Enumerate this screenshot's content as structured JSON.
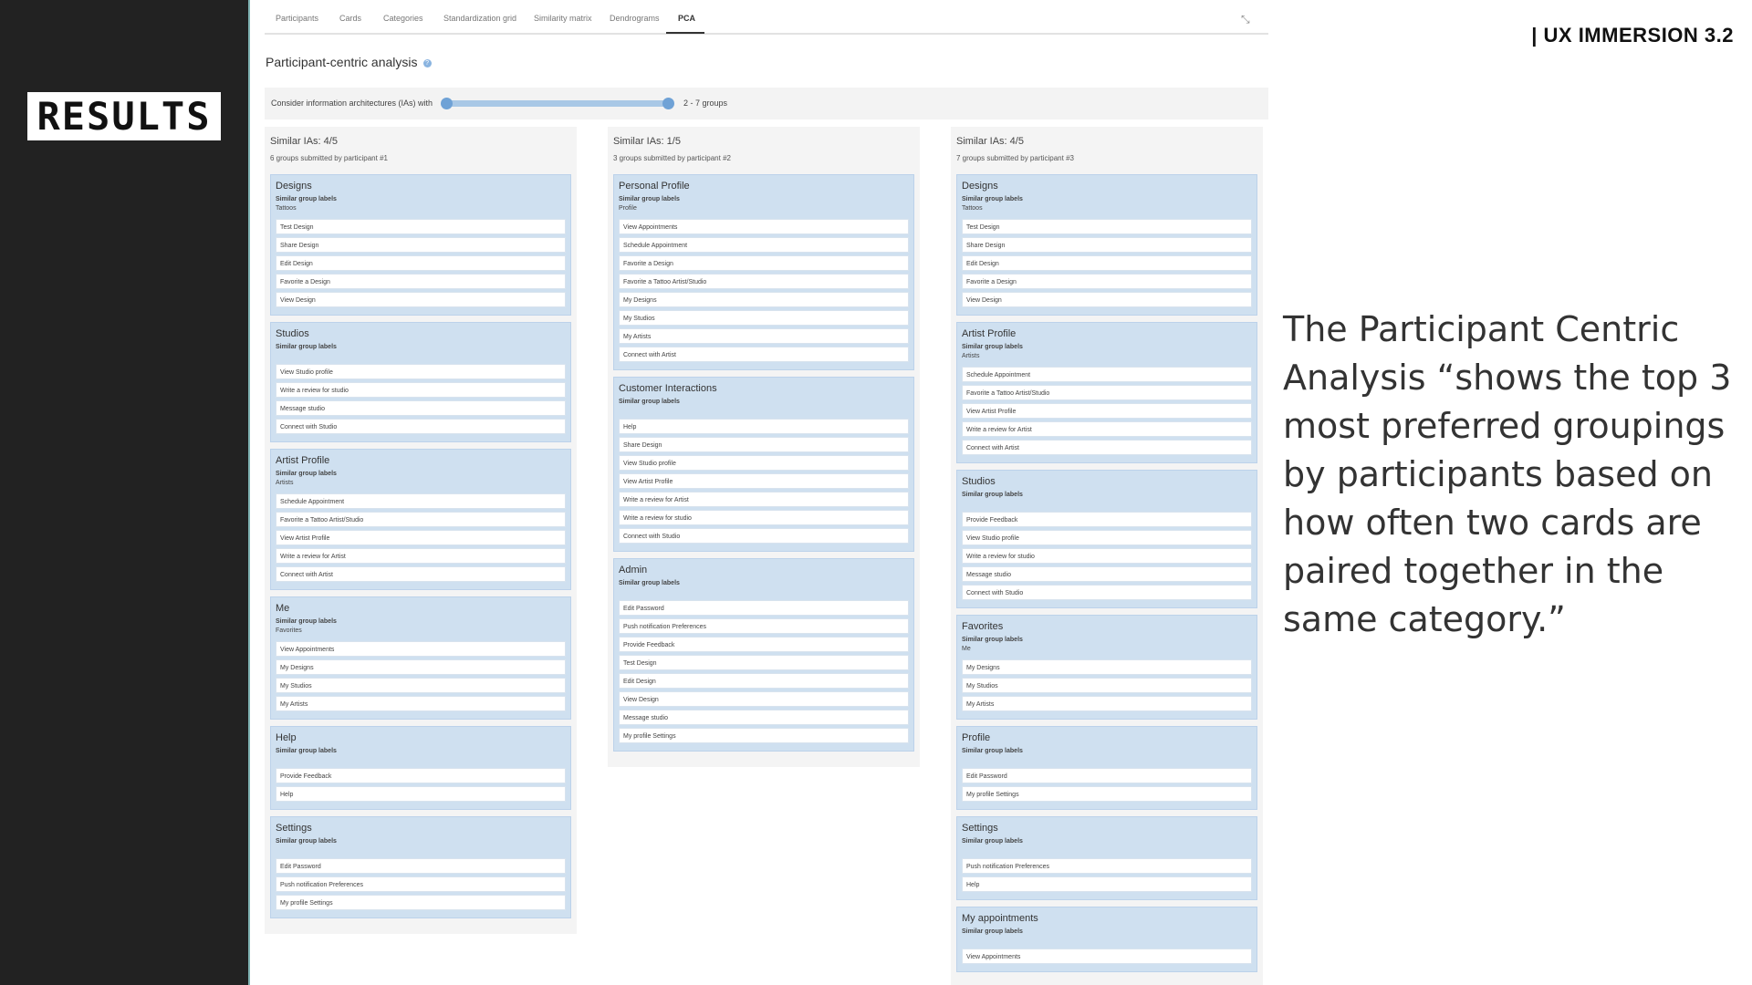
{
  "slide": {
    "results_label": "RESULTS",
    "header": "|  UX IMMERSION 3.2",
    "quote": "The Participant Centric Analysis “shows the top 3 most preferred groupings by participants based on how often two cards are paired together in the same category.”"
  },
  "tabs": [
    {
      "label": "Participants"
    },
    {
      "label": "Cards"
    },
    {
      "label": "Categories"
    },
    {
      "label": "Standardization grid"
    },
    {
      "label": "Similarity matrix"
    },
    {
      "label": "Dendrograms"
    },
    {
      "label": "PCA"
    }
  ],
  "section": {
    "title": "Participant-centric analysis",
    "info_icon": "?"
  },
  "filter": {
    "label": "Consider information architectures (IAs) with",
    "value": "2 - 7 groups"
  },
  "columns": [
    {
      "title": "Similar IAs: 4/5",
      "subtitle": "6 groups submitted by participant #1",
      "groups": [
        {
          "title": "Designs",
          "sub": "Similar group labels",
          "labels": "Tattoos",
          "cards": [
            "Test Design",
            "Share Design",
            "Edit Design",
            "Favorite a Design",
            "View Design"
          ]
        },
        {
          "title": "Studios",
          "sub": "Similar group labels",
          "labels": "",
          "cards": [
            "View Studio profile",
            "Write a review for studio",
            "Message studio",
            "Connect with Studio"
          ]
        },
        {
          "title": "Artist Profile",
          "sub": "Similar group labels",
          "labels": "Artists",
          "cards": [
            "Schedule Appointment",
            "Favorite a Tattoo Artist/Studio",
            "View Artist Profile",
            "Write a review for Artist",
            "Connect with Artist"
          ]
        },
        {
          "title": "Me",
          "sub": "Similar group labels",
          "labels": "Favorites",
          "cards": [
            "View Appointments",
            "My Designs",
            "My Studios",
            "My Artists"
          ]
        },
        {
          "title": "Help",
          "sub": "Similar group labels",
          "labels": "",
          "cards": [
            "Provide Feedback",
            "Help"
          ]
        },
        {
          "title": "Settings",
          "sub": "Similar group labels",
          "labels": "",
          "cards": [
            "Edit Password",
            "Push notification Preferences",
            "My profile Settings"
          ]
        }
      ]
    },
    {
      "title": "Similar IAs: 1/5",
      "subtitle": "3 groups submitted by participant #2",
      "groups": [
        {
          "title": "Personal Profile",
          "sub": "Similar group labels",
          "labels": "Profile",
          "cards": [
            "View Appointments",
            "Schedule Appointment",
            "Favorite a Design",
            "Favorite a Tattoo Artist/Studio",
            "My Designs",
            "My Studios",
            "My Artists",
            "Connect with Artist"
          ]
        },
        {
          "title": "Customer Interactions",
          "sub": "Similar group labels",
          "labels": "",
          "cards": [
            "Help",
            "Share Design",
            "View Studio profile",
            "View Artist Profile",
            "Write a review for Artist",
            "Write a review for studio",
            "Connect with Studio"
          ]
        },
        {
          "title": "Admin",
          "sub": "Similar group labels",
          "labels": "",
          "cards": [
            "Edit Password",
            "Push notification Preferences",
            "Provide Feedback",
            "Test Design",
            "Edit Design",
            "View Design",
            "Message studio",
            "My profile Settings"
          ]
        }
      ]
    },
    {
      "title": "Similar IAs: 4/5",
      "subtitle": "7 groups submitted by participant #3",
      "groups": [
        {
          "title": "Designs",
          "sub": "Similar group labels",
          "labels": "Tattoos",
          "cards": [
            "Test Design",
            "Share Design",
            "Edit Design",
            "Favorite a Design",
            "View Design"
          ]
        },
        {
          "title": "Artist Profile",
          "sub": "Similar group labels",
          "labels": "Artists",
          "cards": [
            "Schedule Appointment",
            "Favorite a Tattoo Artist/Studio",
            "View Artist Profile",
            "Write a review for Artist",
            "Connect with Artist"
          ]
        },
        {
          "title": "Studios",
          "sub": "Similar group labels",
          "labels": "",
          "cards": [
            "Provide Feedback",
            "View Studio profile",
            "Write a review for studio",
            "Message studio",
            "Connect with Studio"
          ]
        },
        {
          "title": "Favorites",
          "sub": "Similar group labels",
          "labels": "Me",
          "cards": [
            "My Designs",
            "My Studios",
            "My Artists"
          ]
        },
        {
          "title": "Profile",
          "sub": "Similar group labels",
          "labels": "",
          "cards": [
            "Edit Password",
            "My profile Settings"
          ]
        },
        {
          "title": "Settings",
          "sub": "Similar group labels",
          "labels": "",
          "cards": [
            "Push notification Preferences",
            "Help"
          ]
        },
        {
          "title": "My appointments",
          "sub": "Similar group labels",
          "labels": "",
          "cards": [
            "View Appointments"
          ]
        }
      ]
    }
  ]
}
